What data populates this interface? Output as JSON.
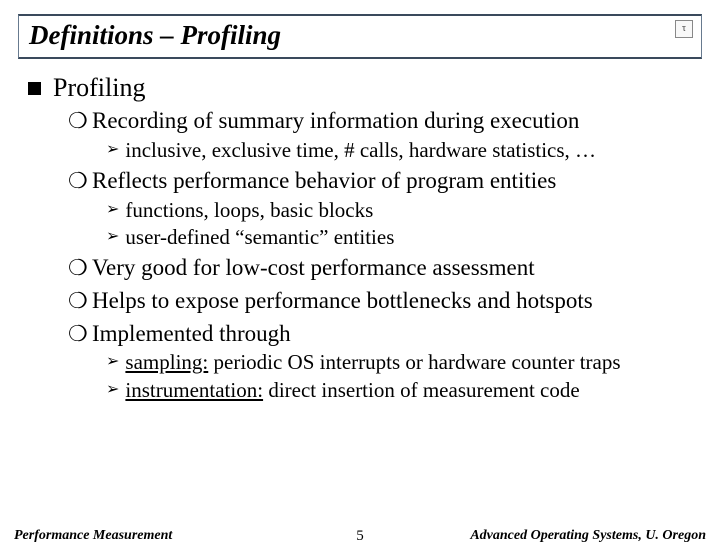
{
  "title": "Definitions – Profiling",
  "logo": "τ",
  "heading": "Profiling",
  "items": [
    {
      "text": "Recording of summary information during execution",
      "sub": [
        {
          "text": "inclusive, exclusive time, # calls, hardware statistics, …"
        }
      ]
    },
    {
      "text": "Reflects performance behavior of program entities",
      "sub": [
        {
          "text": "functions, loops, basic blocks"
        },
        {
          "text": "user-defined “semantic” entities"
        }
      ]
    },
    {
      "text": "Very good for low-cost performance assessment",
      "sub": []
    },
    {
      "text": "Helps to expose performance bottlenecks and hotspots",
      "sub": []
    },
    {
      "text": "Implemented through",
      "sub": [
        {
          "lead": "sampling:",
          "rest": " periodic OS interrupts or hardware counter traps"
        },
        {
          "lead": "instrumentation:",
          "rest": " direct insertion of measurement code"
        }
      ]
    }
  ],
  "footer": {
    "left": "Performance Measurement",
    "center": "5",
    "right": "Advanced Operating Systems, U. Oregon"
  }
}
